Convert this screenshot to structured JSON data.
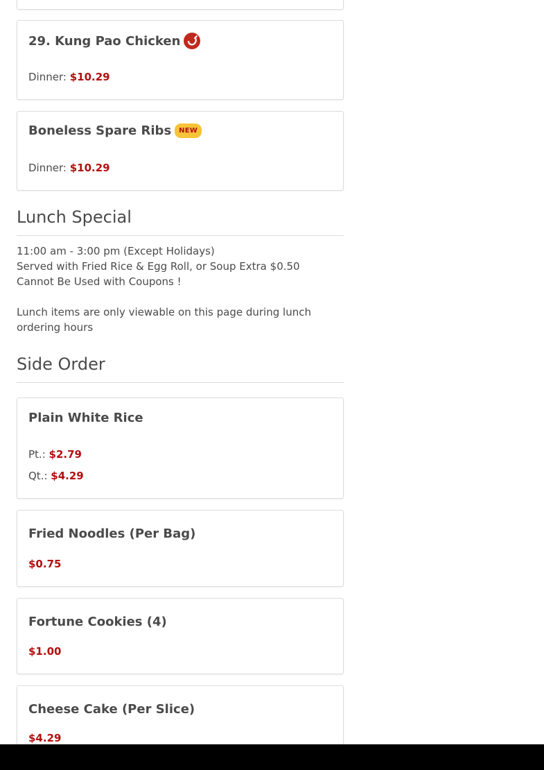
{
  "items_top": [
    {
      "title": "29. Kung Pao Chicken",
      "icon": "spicy-pepper-icon",
      "prices": [
        {
          "label": "Dinner:",
          "price": "$10.29"
        }
      ]
    },
    {
      "title": "Boneless Spare Ribs",
      "badge": "NEW",
      "prices": [
        {
          "label": "Dinner:",
          "price": "$10.29"
        }
      ]
    }
  ],
  "lunch_special": {
    "title": "Lunch Special",
    "lines": [
      "11:00 am - 3:00 pm (Except Holidays)",
      "Served with Fried Rice & Egg Roll, or Soup Extra $0.50",
      "Cannot Be Used with Coupons !"
    ],
    "notice": "Lunch items are only viewable on this page during lunch ordering hours"
  },
  "side_order": {
    "title": "Side Order",
    "items": [
      {
        "title": "Plain White Rice",
        "prices": [
          {
            "label": "Pt.:",
            "price": "$2.79"
          },
          {
            "label": "Qt.:",
            "price": "$4.29"
          }
        ]
      },
      {
        "title": "Fried Noodles (Per Bag)",
        "prices": [
          {
            "label": "",
            "price": "$0.75"
          }
        ]
      },
      {
        "title": "Fortune Cookies (4)",
        "prices": [
          {
            "label": "",
            "price": "$1.00"
          }
        ]
      },
      {
        "title": "Cheese Cake (Per Slice)",
        "prices": [
          {
            "label": "",
            "price": "$4.29"
          }
        ]
      }
    ]
  },
  "colors": {
    "price": "#b30f0f",
    "spicy_icon": "#c0291e",
    "new_badge": "#f7c338",
    "border": "#dcdcdc"
  }
}
